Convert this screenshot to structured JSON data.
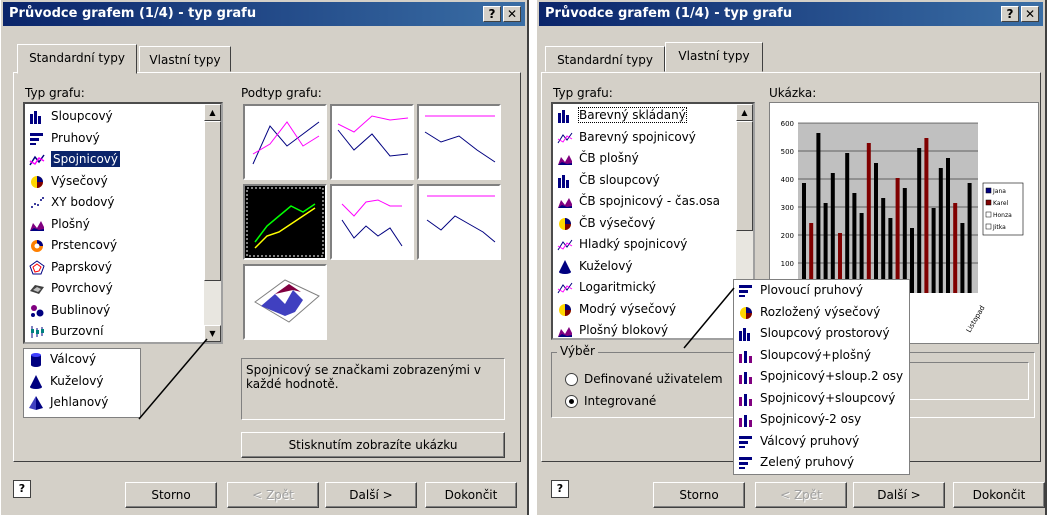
{
  "left": {
    "title": "Průvodce grafem (1/4) - typ grafu",
    "tabs": [
      "Standardní typy",
      "Vlastní typy"
    ],
    "chart_type_label": "Typ grafu:",
    "subtype_label": "Podtyp grafu:",
    "chart_types": [
      "Sloupcový",
      "Pruhový",
      "Spojnicový",
      "Výsečový",
      "XY bodový",
      "Plošný",
      "Prstencový",
      "Paprskový",
      "Povrchový",
      "Bublinový",
      "Burzovní"
    ],
    "selected_index": 2,
    "extra_types": [
      "Válcový",
      "Kuželový",
      "Jehlanový"
    ],
    "description": "Spojnicový se značkami zobrazenými v každé hodnotě.",
    "preview_button": "Stisknutím zobrazíte ukázku",
    "buttons": {
      "cancel": "Storno",
      "back": "< Zpět",
      "next": "Další >",
      "finish": "Dokončit"
    }
  },
  "right": {
    "title": "Průvodce grafem (1/4) - typ grafu",
    "tabs": [
      "Standardní typy",
      "Vlastní typy"
    ],
    "chart_type_label": "Typ grafu:",
    "sample_label": "Ukázka:",
    "chart_types": [
      "Barevný skládaný",
      "Barevný spojnicový",
      "ČB plošný",
      "ČB sloupcový",
      "ČB spojnicový - čas.osa",
      "ČB výsečový",
      "Hladký spojnicový",
      "Kuželový",
      "Logaritmický",
      "Modrý výsečový",
      "Plošný blokový"
    ],
    "extra_types": [
      "Plovoucí pruhový",
      "Rozložený výsečový",
      "Sloupcový prostorový",
      "Sloupcový+plošný",
      "Spojnicový+sloup.2 osy",
      "Spojnicový+sloupcový",
      "Spojnicový-2 osy",
      "Válcový pruhový",
      "Zelený pruhový"
    ],
    "group_label": "Výběr",
    "radio": [
      "Definované uživatelem",
      "Integrované"
    ],
    "radio_selected": 1,
    "buttons": {
      "cancel": "Storno",
      "back": "< Zpět",
      "next": "Další >",
      "finish": "Dokončit"
    },
    "sample_chart": {
      "y_ticks": [
        "600",
        "500",
        "400",
        "300",
        "200",
        "100"
      ],
      "legend": [
        "Jana",
        "Karel",
        "Honza",
        "Jitka"
      ],
      "x_label_visible": "Listopad"
    }
  },
  "colors": {
    "title_start": "#0a246a",
    "title_end": "#3a6ea5",
    "dialog": "#d4d0c8"
  }
}
